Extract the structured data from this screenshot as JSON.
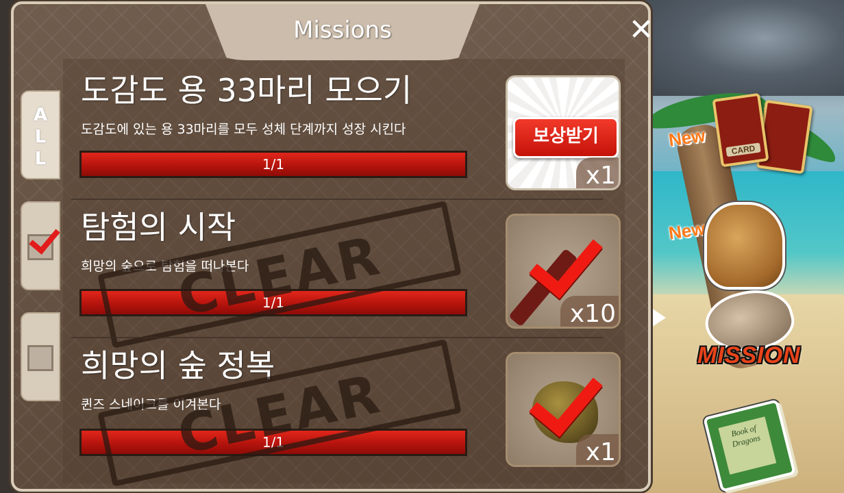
{
  "window": {
    "title": "Missions",
    "close_label": "✕"
  },
  "tabs": [
    {
      "label": "ALL",
      "checked": false
    },
    {
      "label": "",
      "checked": true
    },
    {
      "label": "",
      "checked": false
    }
  ],
  "missions": [
    {
      "title": "도감도 용 33마리 모으기",
      "description": "도감도에 있는 용 33마리를 모두 성체 단계까지 성장 시킨다",
      "progress_text": "1/1",
      "progress": 1.0,
      "cleared": false,
      "reward_count": "x1",
      "claim_label": "보상받기"
    },
    {
      "title": "탐험의 시작",
      "description": "희망의 숲으로 탐험을 떠나본다",
      "progress_text": "1/1",
      "progress": 1.0,
      "cleared": true,
      "stamp": "CLEAR",
      "reward_count": "x10"
    },
    {
      "title": "희망의 숲 정복",
      "description": "퀸즈 스네이크를 이겨본다",
      "progress_text": "1/1",
      "progress": 1.0,
      "cleared": true,
      "stamp": "CLEAR",
      "reward_count": "x1"
    }
  ],
  "side_menu": {
    "new_badge_1": "New",
    "new_badge_2": "New",
    "card_label": "CARD",
    "mission_label": "MISSION",
    "book_title": "Book of Dragons"
  },
  "colors": {
    "bar_fill": "#c4170e",
    "check": "#ef1b12",
    "panel": "#6a5748"
  }
}
